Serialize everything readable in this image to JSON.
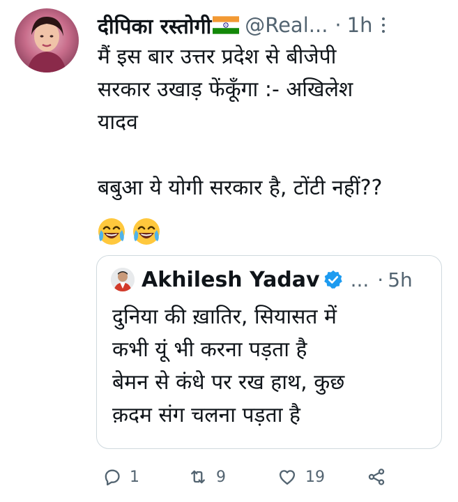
{
  "tweet": {
    "author": {
      "display_name": "दीपिका रस्तोगी",
      "flag_icon": "india-flag-icon",
      "handle": "@Real...",
      "separator": "·",
      "time": "1h"
    },
    "text": "मैं इस बार उत्तर प्रदेश से बीजेपी\nसरकार उखाड़ फेंकूँगा :- अखिलेश\nयादव\n\nबबुआ ये योगी सरकार है, टोंटी नहीं??",
    "emojis": [
      "😂",
      "😂"
    ],
    "quoted_tweet": {
      "display_name": "Akhilesh Yadav",
      "verified_icon": "verified-badge-icon",
      "ellipsis": "...",
      "separator": "·",
      "time": "5h",
      "text": "दुनिया की ख़ातिर, सियासत में\nकभी यूं भी करना पड़ता है\nबेमन से कंधे पर रख हाथ, कुछ\nक़दम संग चलना पड़ता है"
    },
    "actions": {
      "reply_count": "1",
      "retweet_count": "9",
      "like_count": "19"
    }
  },
  "colors": {
    "text_primary": "#0f1419",
    "text_secondary": "#536471",
    "border": "#cfd9de",
    "verified_blue": "#1d9bf0",
    "emoji_yellow": "#ffc83d"
  }
}
